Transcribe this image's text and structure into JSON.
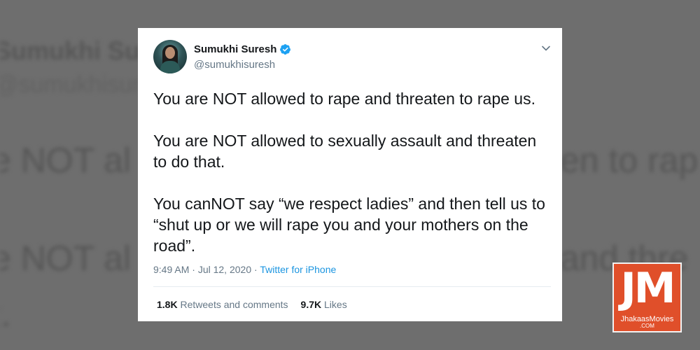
{
  "background": {
    "name_fragment": "Sumukhi Sure",
    "handle_fragment": "@sumukhisure",
    "line1_left": "e NOT al",
    "line1_right": "en to rap",
    "line2_left": "e NOT al",
    "line2_right": "and thre",
    "line3_left": "t."
  },
  "tweet": {
    "author_name": "Sumukhi Suresh",
    "handle": "@sumukhisuresh",
    "paragraphs": [
      "You are NOT allowed to rape and threaten to rape us.",
      "You are NOT allowed to sexually assault and threaten to do that.",
      "You canNOT say “we respect ladies” and then tell us to “shut up or we will rape you and your mothers on the road”."
    ],
    "time": "9:49 AM",
    "date": "Jul 12, 2020",
    "separator": " · ",
    "source": "Twitter for iPhone",
    "retweets_count": "1.8K",
    "retweets_label": "Retweets and comments",
    "likes_count": "9.7K",
    "likes_label": "Likes"
  },
  "watermark": {
    "letters": "JM",
    "text": "JhakaasMovies",
    "sub": ".COM"
  },
  "colors": {
    "verified": "#1da1f2",
    "link": "#1b95e0",
    "logo_bg": "#e04f2a"
  },
  "icons": [
    "verified-badge-icon",
    "chevron-down-icon"
  ]
}
